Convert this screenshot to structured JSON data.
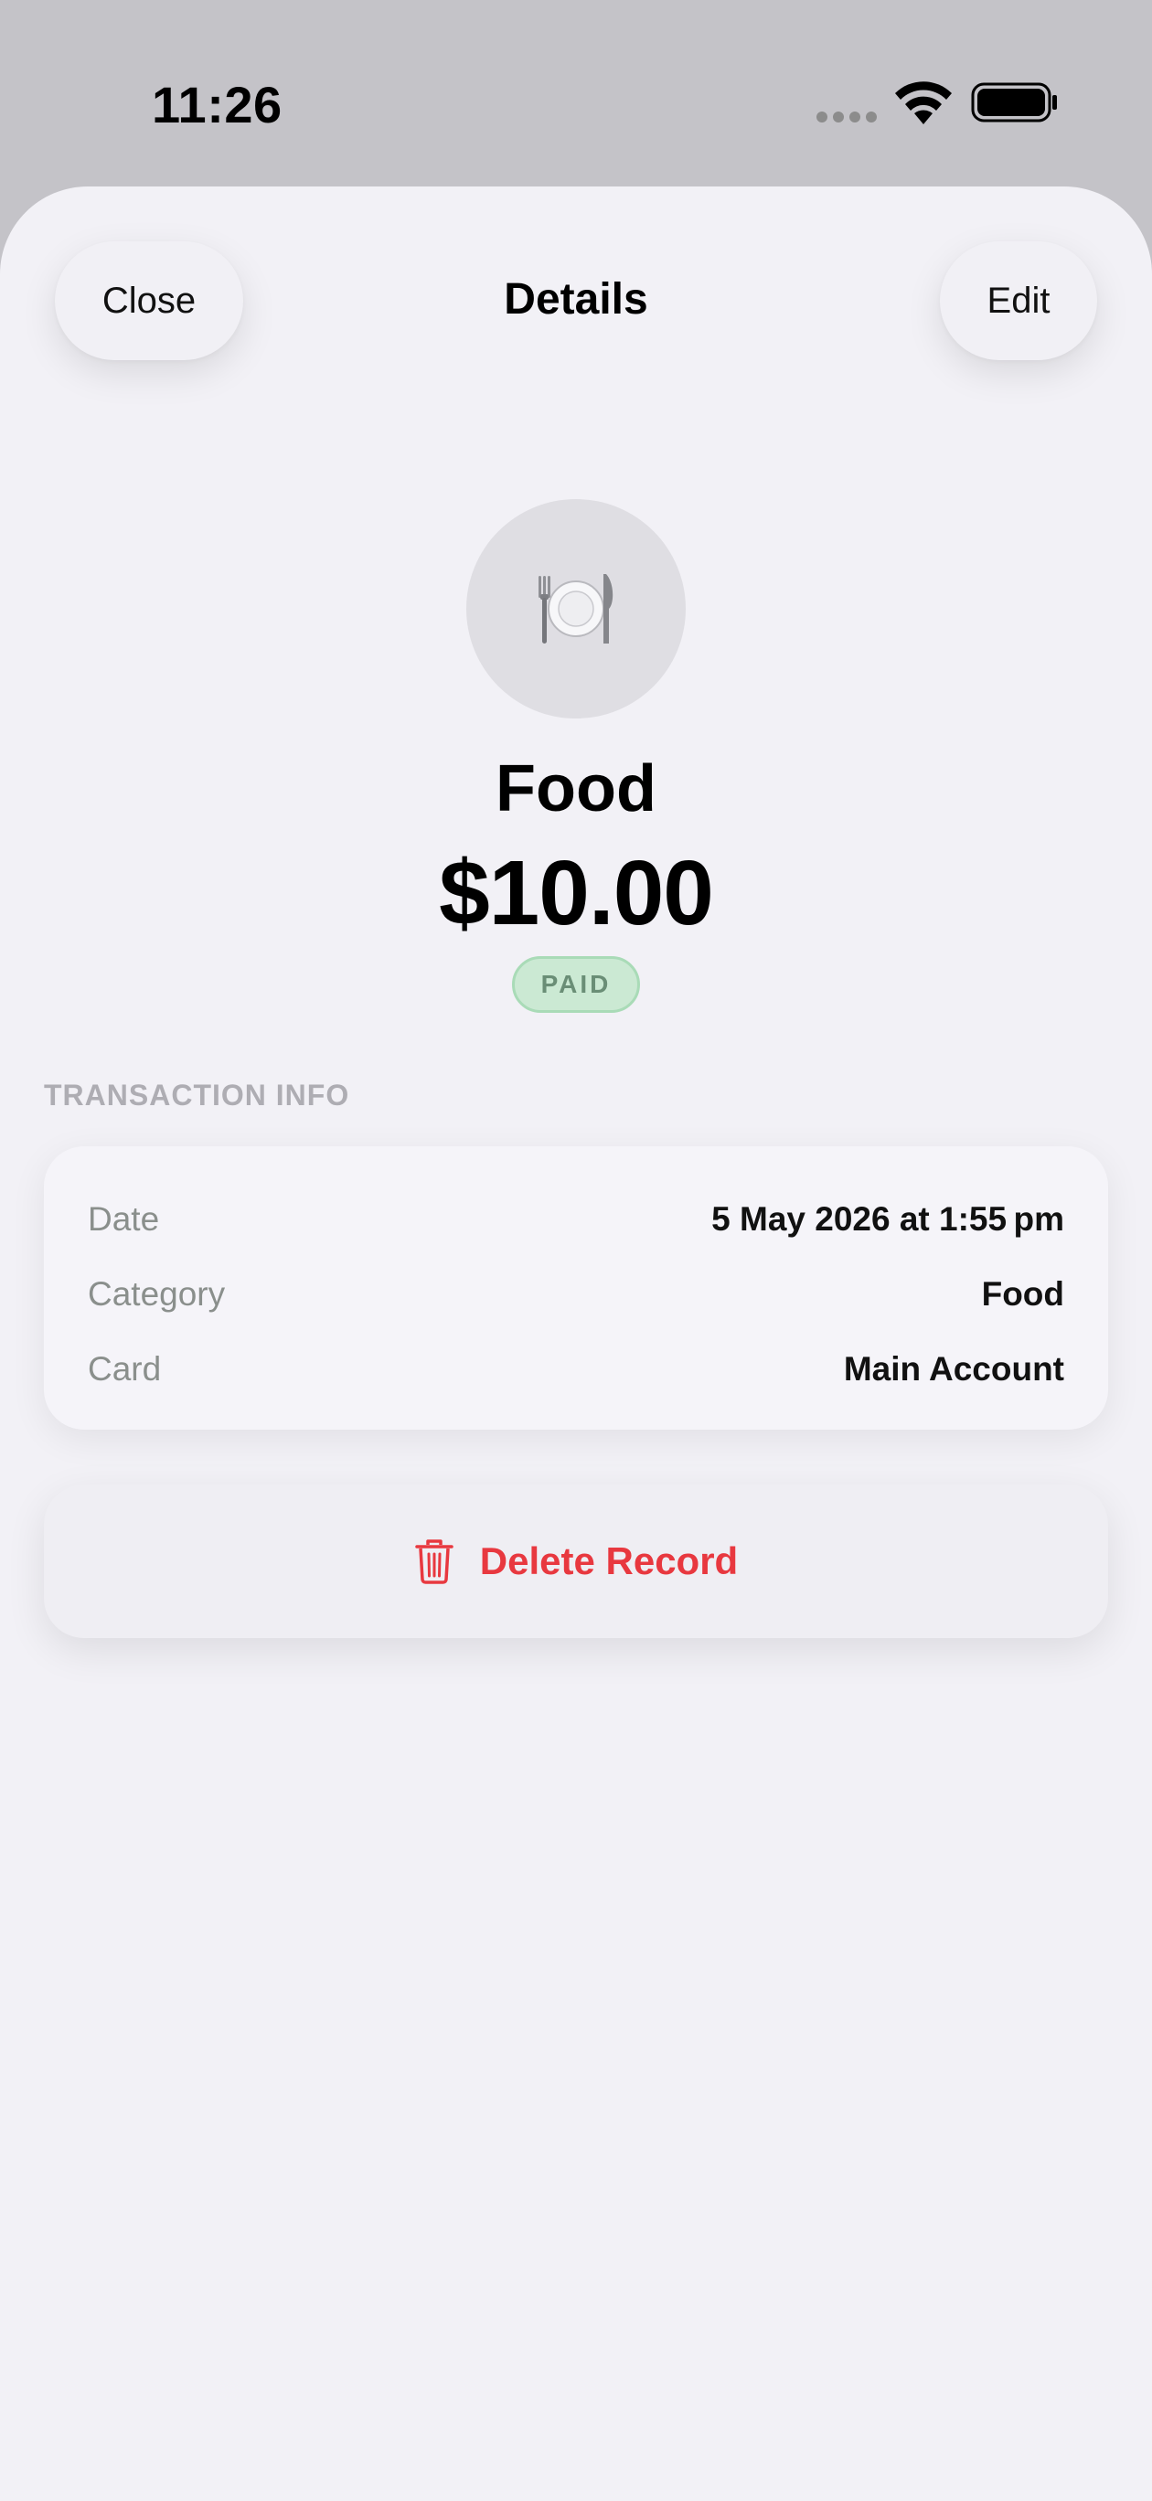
{
  "status_bar": {
    "time": "11:26"
  },
  "header": {
    "close_label": "Close",
    "title": "Details",
    "edit_label": "Edit"
  },
  "record": {
    "category_icon": "fork-knife-plate-icon",
    "name": "Food",
    "amount": "$10.00",
    "status": "PAID"
  },
  "transaction_info": {
    "section_title": "TRANSACTION INFO",
    "rows": [
      {
        "label": "Date",
        "value": "5 May 2026 at 1:55 pm"
      },
      {
        "label": "Category",
        "value": "Food"
      },
      {
        "label": "Card",
        "value": "Main Account"
      }
    ]
  },
  "actions": {
    "delete_label": "Delete Record",
    "delete_icon": "trash-icon"
  },
  "colors": {
    "sheet_background": "#f2f1f6",
    "status_paid_bg": "#cbe9d3",
    "status_paid_text": "#6a8e76",
    "destructive": "#e8383f"
  }
}
